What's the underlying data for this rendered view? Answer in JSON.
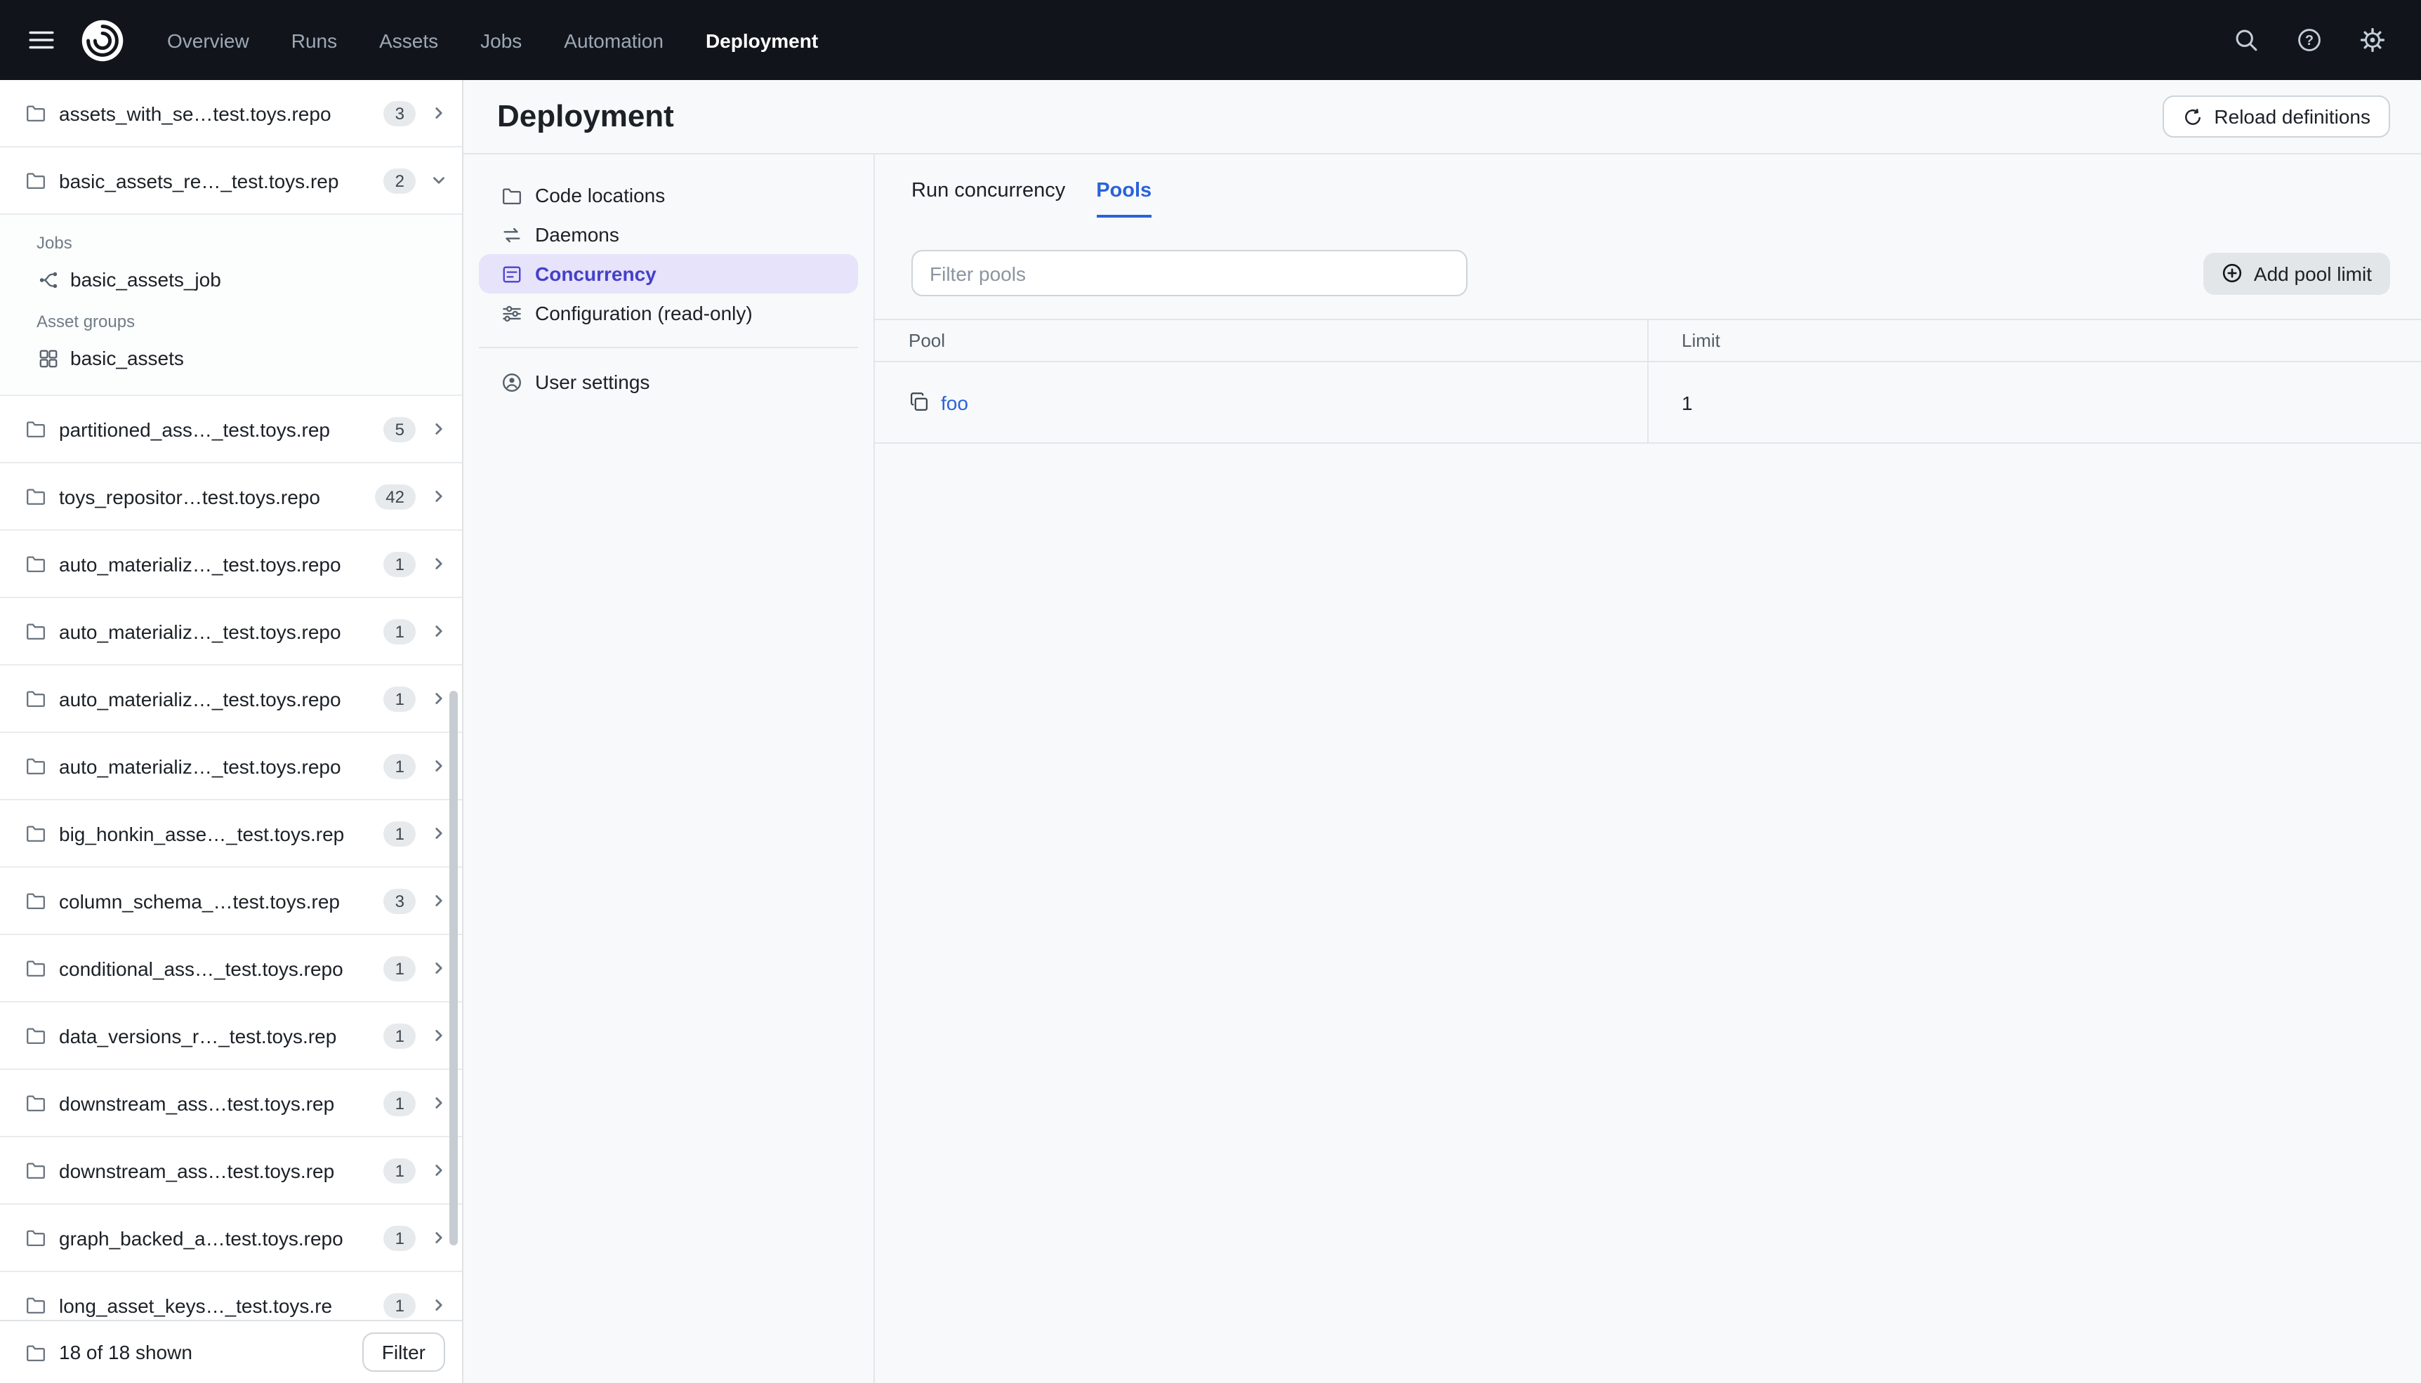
{
  "topnav": {
    "items": [
      {
        "label": "Overview",
        "active": false
      },
      {
        "label": "Runs",
        "active": false
      },
      {
        "label": "Assets",
        "active": false
      },
      {
        "label": "Jobs",
        "active": false
      },
      {
        "label": "Automation",
        "active": false
      },
      {
        "label": "Deployment",
        "active": true
      }
    ]
  },
  "sidebar": {
    "repos": [
      {
        "name": "assets_with_se…test.toys.repo",
        "count": "3",
        "expanded": false
      },
      {
        "name": "basic_assets_re…_test.toys.rep",
        "count": "2",
        "expanded": true,
        "sections": [
          {
            "label": "Jobs",
            "items": [
              {
                "icon": "job-icon",
                "name": "basic_assets_job"
              }
            ]
          },
          {
            "label": "Asset groups",
            "items": [
              {
                "icon": "asset-group-icon",
                "name": "basic_assets"
              }
            ]
          }
        ]
      },
      {
        "name": "partitioned_ass…_test.toys.rep",
        "count": "5",
        "expanded": false
      },
      {
        "name": "toys_repositor…test.toys.repo",
        "count": "42",
        "expanded": false
      },
      {
        "name": "auto_materializ…_test.toys.repo",
        "count": "1",
        "expanded": false
      },
      {
        "name": "auto_materializ…_test.toys.repo",
        "count": "1",
        "expanded": false
      },
      {
        "name": "auto_materializ…_test.toys.repo",
        "count": "1",
        "expanded": false
      },
      {
        "name": "auto_materializ…_test.toys.repo",
        "count": "1",
        "expanded": false
      },
      {
        "name": "big_honkin_asse…_test.toys.rep",
        "count": "1",
        "expanded": false
      },
      {
        "name": "column_schema_…test.toys.rep",
        "count": "3",
        "expanded": false
      },
      {
        "name": "conditional_ass…_test.toys.repo",
        "count": "1",
        "expanded": false
      },
      {
        "name": "data_versions_r…_test.toys.rep",
        "count": "1",
        "expanded": false
      },
      {
        "name": "downstream_ass…test.toys.rep",
        "count": "1",
        "expanded": false
      },
      {
        "name": "downstream_ass…test.toys.rep",
        "count": "1",
        "expanded": false
      },
      {
        "name": "graph_backed_a…test.toys.repo",
        "count": "1",
        "expanded": false
      },
      {
        "name": "long_asset_keys…_test.toys.re",
        "count": "1",
        "expanded": false
      }
    ],
    "footer": {
      "shown_label": "18 of 18 shown",
      "filter_button": "Filter"
    }
  },
  "main": {
    "title": "Deployment",
    "reload_button": "Reload definitions",
    "subnav": [
      {
        "label": "Code locations",
        "icon": "folder-icon",
        "active": false
      },
      {
        "label": "Daemons",
        "icon": "daemons-icon",
        "active": false
      },
      {
        "label": "Concurrency",
        "icon": "concurrency-icon",
        "active": true
      },
      {
        "label": "Configuration (read-only)",
        "icon": "configuration-icon",
        "active": false
      }
    ],
    "user_settings": {
      "label": "User settings",
      "icon": "user-icon"
    },
    "tabs": [
      {
        "label": "Run concurrency",
        "active": false
      },
      {
        "label": "Pools",
        "active": true
      }
    ],
    "pools": {
      "filter_placeholder": "Filter pools",
      "add_button": "Add pool limit",
      "table": {
        "columns": [
          "Pool",
          "Limit"
        ],
        "rows": [
          {
            "pool": "foo",
            "limit": "1"
          }
        ]
      }
    }
  },
  "colors": {
    "topnav_bg": "#11151b",
    "selected_nav_bg": "#e6e3fb",
    "selected_nav_text": "#4440c9",
    "active_tab_blue": "#2a63d9",
    "link_blue": "#2a63d9"
  }
}
